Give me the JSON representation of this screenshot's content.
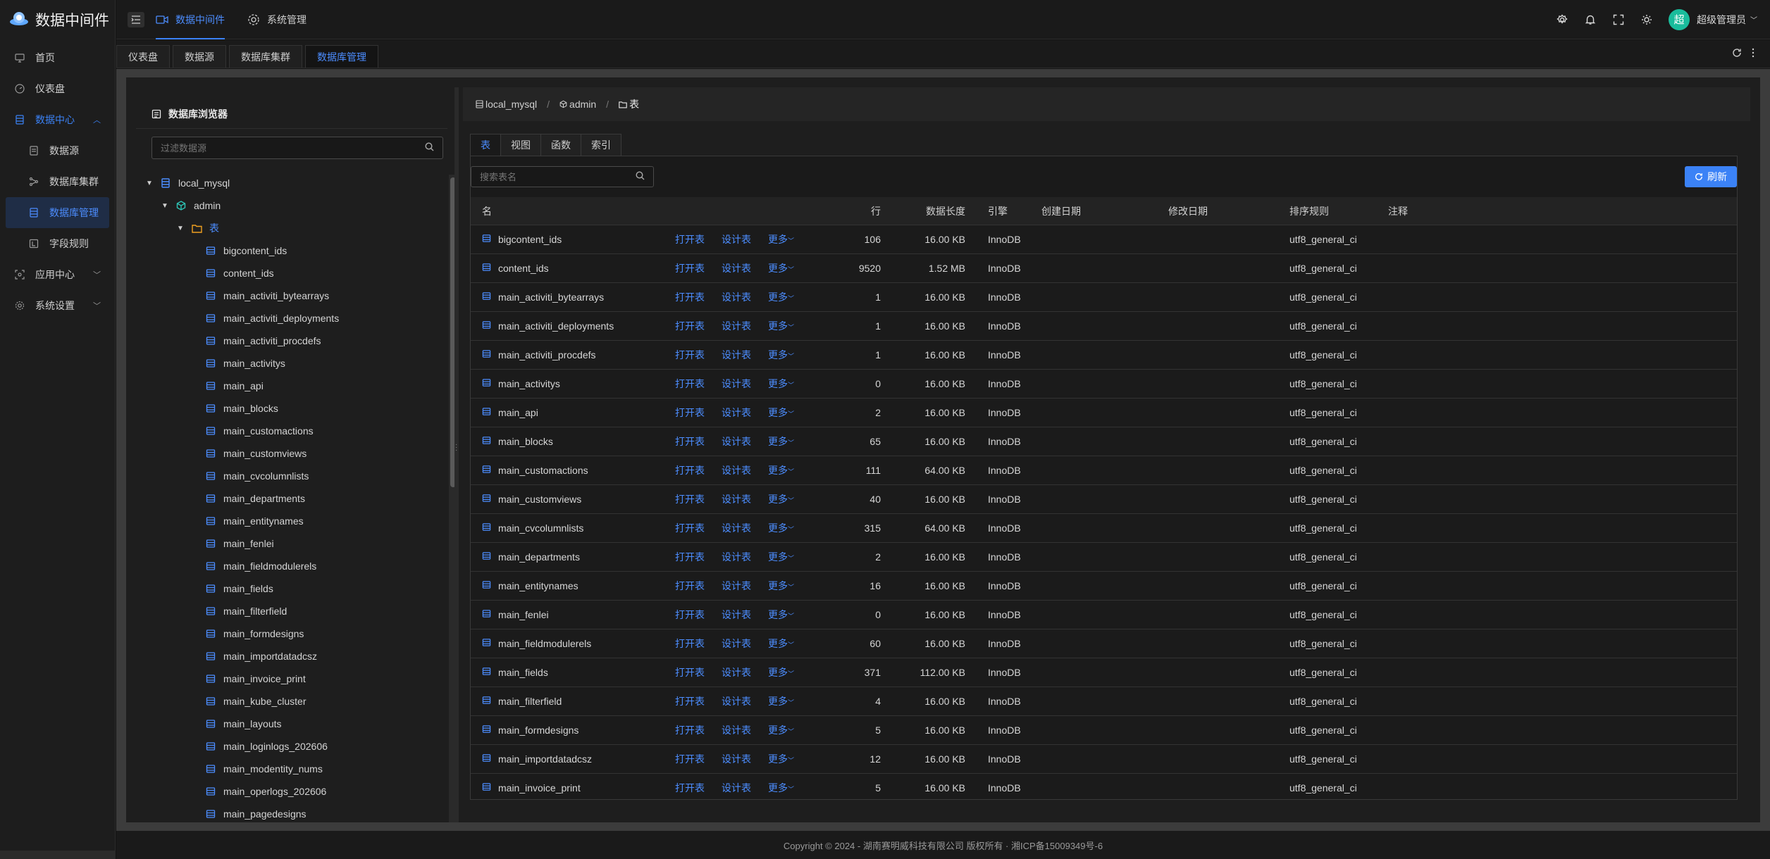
{
  "app": {
    "title": "数据中间件"
  },
  "sidebar": {
    "items": [
      {
        "label": "首页",
        "icon": "monitor-icon"
      },
      {
        "label": "仪表盘",
        "icon": "gauge-icon"
      },
      {
        "label": "数据中心",
        "icon": "database-icon",
        "open": true,
        "children": [
          {
            "label": "数据源",
            "icon": "db-icon"
          },
          {
            "label": "数据库集群",
            "icon": "share-icon"
          },
          {
            "label": "数据库管理",
            "icon": "db-manage-icon",
            "active": true
          },
          {
            "label": "字段规则",
            "icon": "rule-icon"
          }
        ]
      },
      {
        "label": "应用中心",
        "icon": "app-icon"
      },
      {
        "label": "系统设置",
        "icon": "gear-icon"
      }
    ]
  },
  "header": {
    "tabs": [
      {
        "label": "数据中间件",
        "icon": "video-icon",
        "active": true
      },
      {
        "label": "系统管理",
        "icon": "gear-icon",
        "active": false
      }
    ],
    "user": {
      "avatar": "超",
      "name": "超级管理员"
    }
  },
  "page_tabs": [
    {
      "label": "仪表盘"
    },
    {
      "label": "数据源"
    },
    {
      "label": "数据库集群"
    },
    {
      "label": "数据库管理",
      "active": true
    }
  ],
  "browser": {
    "title": "数据库浏览器",
    "filter_placeholder": "过滤数据源",
    "tree": {
      "datasource": "local_mysql",
      "schema": "admin",
      "folder": "表",
      "tables": [
        "bigcontent_ids",
        "content_ids",
        "main_activiti_bytearrays",
        "main_activiti_deployments",
        "main_activiti_procdefs",
        "main_activitys",
        "main_api",
        "main_blocks",
        "main_customactions",
        "main_customviews",
        "main_cvcolumnlists",
        "main_departments",
        "main_entitynames",
        "main_fenlei",
        "main_fieldmodulerels",
        "main_fields",
        "main_filterfield",
        "main_formdesigns",
        "main_importdatadcsz",
        "main_invoice_print",
        "main_kube_cluster",
        "main_layouts",
        "main_loginlogs_202606",
        "main_modentity_nums",
        "main_operlogs_202606",
        "main_pagedesigns"
      ]
    }
  },
  "breadcrumb": [
    "local_mysql",
    "admin",
    "表"
  ],
  "sub_tabs": [
    {
      "label": "表",
      "active": true
    },
    {
      "label": "视图"
    },
    {
      "label": "函数"
    },
    {
      "label": "索引"
    }
  ],
  "table_view": {
    "search_placeholder": "搜索表名",
    "refresh_label": "刷新",
    "actions": {
      "open": "打开表",
      "design": "设计表",
      "more": "更多"
    },
    "columns": {
      "name": "名",
      "rows": "行",
      "size": "数据长度",
      "engine": "引擎",
      "created": "创建日期",
      "modified": "修改日期",
      "collation": "排序规则",
      "comment": "注释"
    },
    "rows": [
      {
        "name": "bigcontent_ids",
        "rows": "106",
        "size": "16.00 KB",
        "engine": "InnoDB",
        "collation": "utf8_general_ci"
      },
      {
        "name": "content_ids",
        "rows": "9520",
        "size": "1.52 MB",
        "engine": "InnoDB",
        "collation": "utf8_general_ci"
      },
      {
        "name": "main_activiti_bytearrays",
        "rows": "1",
        "size": "16.00 KB",
        "engine": "InnoDB",
        "collation": "utf8_general_ci"
      },
      {
        "name": "main_activiti_deployments",
        "rows": "1",
        "size": "16.00 KB",
        "engine": "InnoDB",
        "collation": "utf8_general_ci"
      },
      {
        "name": "main_activiti_procdefs",
        "rows": "1",
        "size": "16.00 KB",
        "engine": "InnoDB",
        "collation": "utf8_general_ci"
      },
      {
        "name": "main_activitys",
        "rows": "0",
        "size": "16.00 KB",
        "engine": "InnoDB",
        "collation": "utf8_general_ci"
      },
      {
        "name": "main_api",
        "rows": "2",
        "size": "16.00 KB",
        "engine": "InnoDB",
        "collation": "utf8_general_ci"
      },
      {
        "name": "main_blocks",
        "rows": "65",
        "size": "16.00 KB",
        "engine": "InnoDB",
        "collation": "utf8_general_ci"
      },
      {
        "name": "main_customactions",
        "rows": "111",
        "size": "64.00 KB",
        "engine": "InnoDB",
        "collation": "utf8_general_ci"
      },
      {
        "name": "main_customviews",
        "rows": "40",
        "size": "16.00 KB",
        "engine": "InnoDB",
        "collation": "utf8_general_ci"
      },
      {
        "name": "main_cvcolumnlists",
        "rows": "315",
        "size": "64.00 KB",
        "engine": "InnoDB",
        "collation": "utf8_general_ci"
      },
      {
        "name": "main_departments",
        "rows": "2",
        "size": "16.00 KB",
        "engine": "InnoDB",
        "collation": "utf8_general_ci"
      },
      {
        "name": "main_entitynames",
        "rows": "16",
        "size": "16.00 KB",
        "engine": "InnoDB",
        "collation": "utf8_general_ci"
      },
      {
        "name": "main_fenlei",
        "rows": "0",
        "size": "16.00 KB",
        "engine": "InnoDB",
        "collation": "utf8_general_ci"
      },
      {
        "name": "main_fieldmodulerels",
        "rows": "60",
        "size": "16.00 KB",
        "engine": "InnoDB",
        "collation": "utf8_general_ci"
      },
      {
        "name": "main_fields",
        "rows": "371",
        "size": "112.00 KB",
        "engine": "InnoDB",
        "collation": "utf8_general_ci"
      },
      {
        "name": "main_filterfield",
        "rows": "4",
        "size": "16.00 KB",
        "engine": "InnoDB",
        "collation": "utf8_general_ci"
      },
      {
        "name": "main_formdesigns",
        "rows": "5",
        "size": "16.00 KB",
        "engine": "InnoDB",
        "collation": "utf8_general_ci"
      },
      {
        "name": "main_importdatadcsz",
        "rows": "12",
        "size": "16.00 KB",
        "engine": "InnoDB",
        "collation": "utf8_general_ci"
      },
      {
        "name": "main_invoice_print",
        "rows": "5",
        "size": "16.00 KB",
        "engine": "InnoDB",
        "collation": "utf8_general_ci"
      }
    ]
  },
  "footer": {
    "text": "Copyright © 2024 - 湖南赛明威科技有限公司 版权所有 · 湘ICP备15009349号-6"
  },
  "colors": {
    "accent": "#3b82f6",
    "avatar": "#1abc9c",
    "background": "#141414"
  }
}
